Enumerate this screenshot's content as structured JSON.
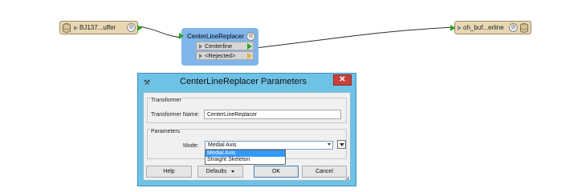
{
  "workspace": {
    "reader": {
      "label": "BJ137...uffer",
      "icon": "database-icon"
    },
    "writer": {
      "label": "oh_buf...erline",
      "icon": "database-icon"
    },
    "transformer": {
      "name": "CenterLineReplacer",
      "ports": [
        "Centerline",
        "<Rejected>"
      ],
      "color": "#7fb5ea"
    },
    "connection_color": "#2f2f2f"
  },
  "dialog": {
    "title": "CenterLineReplacer Parameters",
    "close_label": "✕",
    "title_bar_color": "#6ec2e6",
    "groups": {
      "transformer": {
        "title": "Transformer",
        "name_label": "Transformer Name:",
        "name_value": "CenterLineReplacer"
      },
      "parameters": {
        "title": "Parameters",
        "mode_label": "Mode:",
        "mode_value": "Medial Axis",
        "mode_options": [
          "Medial Axis",
          "Straight Skeleton"
        ],
        "highlighted_option": "Medial Axis"
      }
    },
    "buttons": {
      "help": "Help",
      "defaults": "Defaults",
      "ok": "OK",
      "cancel": "Cancel"
    }
  }
}
